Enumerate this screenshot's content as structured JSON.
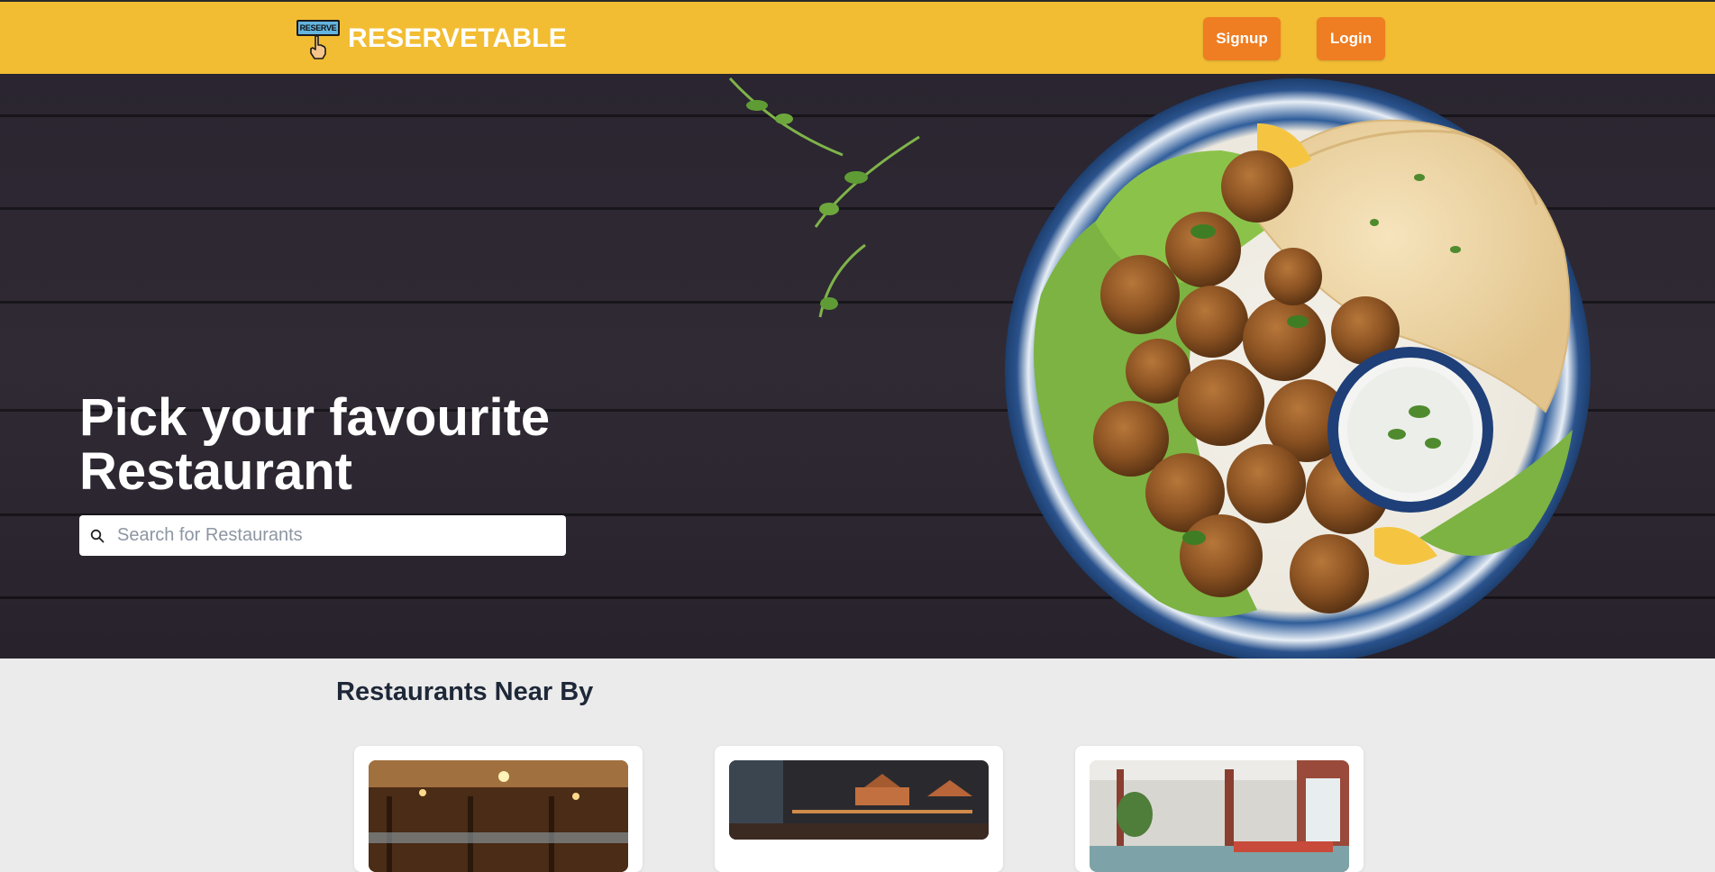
{
  "navbar": {
    "logo_text": "RESERVE",
    "brand_name": "RESERVETABLE",
    "signup_label": "Signup",
    "login_label": "Login"
  },
  "hero": {
    "title_line1": "Pick your favourite",
    "title_line2": "Restaurant",
    "search": {
      "placeholder": "Search for Restaurants",
      "value": ""
    }
  },
  "restaurants": {
    "section_title": "Restaurants Near By"
  },
  "colors": {
    "navbar_bg": "#f2bd33",
    "button_bg": "#ef7d22",
    "page_bg": "#ebebeb",
    "heading_text": "#1e2838"
  },
  "icons": [
    "reserve-logo-icon",
    "pointing-hand-icon",
    "search-icon"
  ]
}
